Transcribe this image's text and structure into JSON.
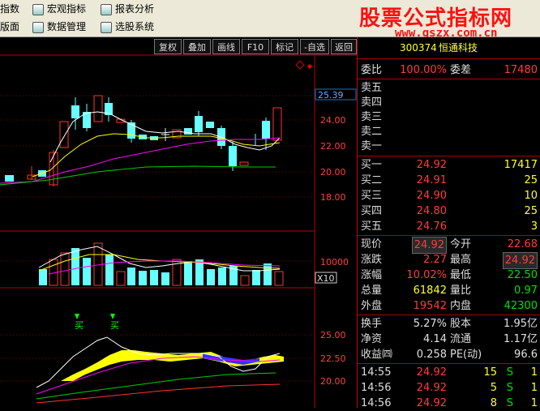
{
  "menu": {
    "item1": "指数",
    "item2": "宏观指标",
    "item3": "报表分析",
    "item4": "版面",
    "item5": "数据管理",
    "item6": "选股系统"
  },
  "watermark": {
    "title": "股票公式指标网",
    "url": "www.gszx.com.cn"
  },
  "toolbar": {
    "b1": "复权",
    "b2": "叠加",
    "b3": "画线",
    "b4": "F10",
    "b5": "标记",
    "b6": "-自选",
    "b7": "返回"
  },
  "chart_data": {
    "type": "candlestick",
    "price_axis": {
      "ticks": [
        "24.00",
        "22.00",
        "20.00",
        "18.00"
      ],
      "current": "25.39"
    },
    "volume_axis": {
      "tick": "10000",
      "unit": "X10"
    },
    "indicator_axis": {
      "ticks": [
        "25.00",
        "22.50",
        "20.00"
      ]
    },
    "markers": [
      "买",
      "买"
    ]
  },
  "quote": {
    "code": "300374",
    "name": "恒通科技",
    "weibi_label": "委比",
    "weibi": "100.00%",
    "weicha_label": "委差",
    "weicha": "17480",
    "sells": [
      {
        "l": "卖五"
      },
      {
        "l": "卖四"
      },
      {
        "l": "卖三"
      },
      {
        "l": "卖二"
      },
      {
        "l": "卖一"
      }
    ],
    "buys": [
      {
        "l": "买一",
        "p": "24.92",
        "v": "17417"
      },
      {
        "l": "买二",
        "p": "24.91",
        "v": "25"
      },
      {
        "l": "买三",
        "p": "24.90",
        "v": "10"
      },
      {
        "l": "买四",
        "p": "24.80",
        "v": "25"
      },
      {
        "l": "买五",
        "p": "24.76",
        "v": "3"
      }
    ],
    "stats": [
      {
        "l1": "现价",
        "v1": "24.92",
        "l2": "今开",
        "v2": "22.68"
      },
      {
        "l1": "涨跌",
        "v1": "2.27",
        "l2": "最高",
        "v2": "24.92"
      },
      {
        "l1": "涨幅",
        "v1": "10.02%",
        "l2": "最低",
        "v2": "22.50"
      },
      {
        "l1": "总量",
        "v1": "61842",
        "l2": "量比",
        "v2": "0.97"
      },
      {
        "l1": "外盘",
        "v1": "19542",
        "l2": "内盘",
        "v2": "42300"
      }
    ],
    "fin": [
      {
        "l1": "换手",
        "v1": "5.27%",
        "l2": "股本",
        "v2": "1.95亿"
      },
      {
        "l1": "净资",
        "v1": "4.14",
        "l2": "流通",
        "v2": "1.17亿"
      },
      {
        "l1": "收益㈣",
        "v1": "0.258",
        "l2": "PE(动)",
        "v2": "96.6"
      }
    ],
    "ticks": [
      {
        "t": "14:55",
        "p": "24.92",
        "v": "15",
        "s": "S",
        "n": "1"
      },
      {
        "t": "14:56",
        "p": "24.92",
        "v": "5",
        "s": "S",
        "n": "1"
      },
      {
        "t": "14:56",
        "p": "24.92",
        "v": "8",
        "s": "S",
        "n": "1"
      }
    ]
  }
}
